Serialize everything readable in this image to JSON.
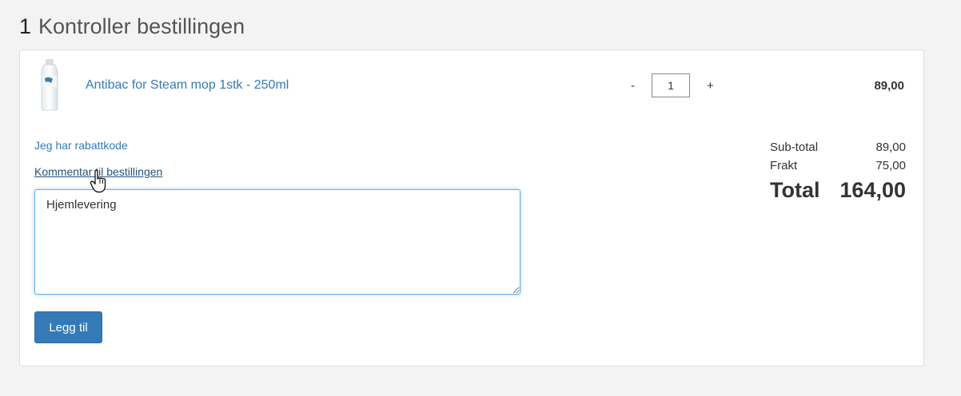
{
  "header": {
    "step": "1",
    "title": "Kontroller bestillingen"
  },
  "cart": {
    "items": [
      {
        "name": "Antibac for Steam mop 1stk - 250ml",
        "image_icon": "bottle-icon",
        "qty_minus": "-",
        "qty_plus": "+",
        "quantity": "1",
        "price": "89,00"
      }
    ]
  },
  "discount": {
    "link_label": "Jeg har rabattkode"
  },
  "comment": {
    "link_label": "Kommentar til bestillingen",
    "value": "Hjemlevering",
    "submit_label": "Legg til"
  },
  "totals": {
    "subtotal_label": "Sub-total",
    "subtotal_value": "89,00",
    "shipping_label": "Frakt",
    "shipping_value": "75,00",
    "total_label": "Total",
    "total_value": "164,00"
  },
  "colors": {
    "link": "#337ab7",
    "button": "#337ab7",
    "focus_border": "#66afe9"
  }
}
